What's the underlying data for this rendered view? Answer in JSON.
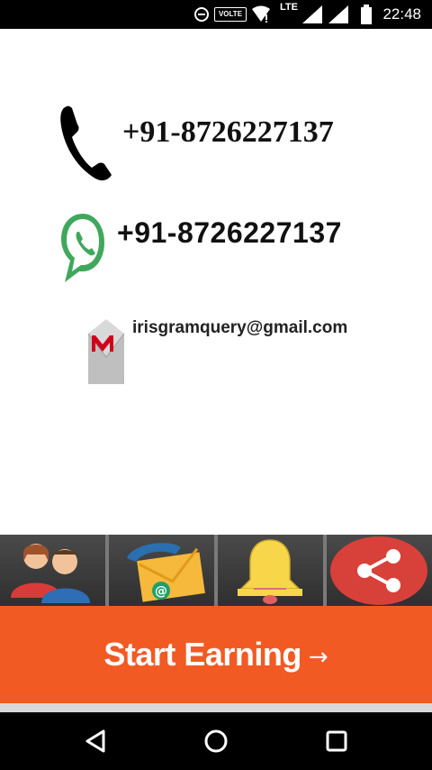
{
  "status_bar": {
    "time": "22:48",
    "volte_label": "VOLTE",
    "lte_label": "LTE",
    "icons": [
      "data-saver-icon",
      "volte-icon",
      "wifi-icon",
      "lte-signal-icon",
      "signal-icon",
      "battery-icon"
    ]
  },
  "contacts": {
    "phone": {
      "icon": "phone-icon",
      "text": "+91-8726227137"
    },
    "whatsapp": {
      "icon": "whatsapp-icon",
      "text": "+91-8726227137"
    },
    "email": {
      "icon": "gmail-icon",
      "text": "irisgramquery@gmail.com"
    }
  },
  "tiles": [
    {
      "icon": "users-icon"
    },
    {
      "icon": "contact-mail-icon"
    },
    {
      "icon": "bell-icon"
    },
    {
      "icon": "share-icon"
    }
  ],
  "cta": {
    "label": "Start Earning",
    "arrow": "→",
    "color": "#f25a24"
  },
  "nav": {
    "icons": [
      "back-icon",
      "home-icon",
      "recents-icon"
    ]
  }
}
